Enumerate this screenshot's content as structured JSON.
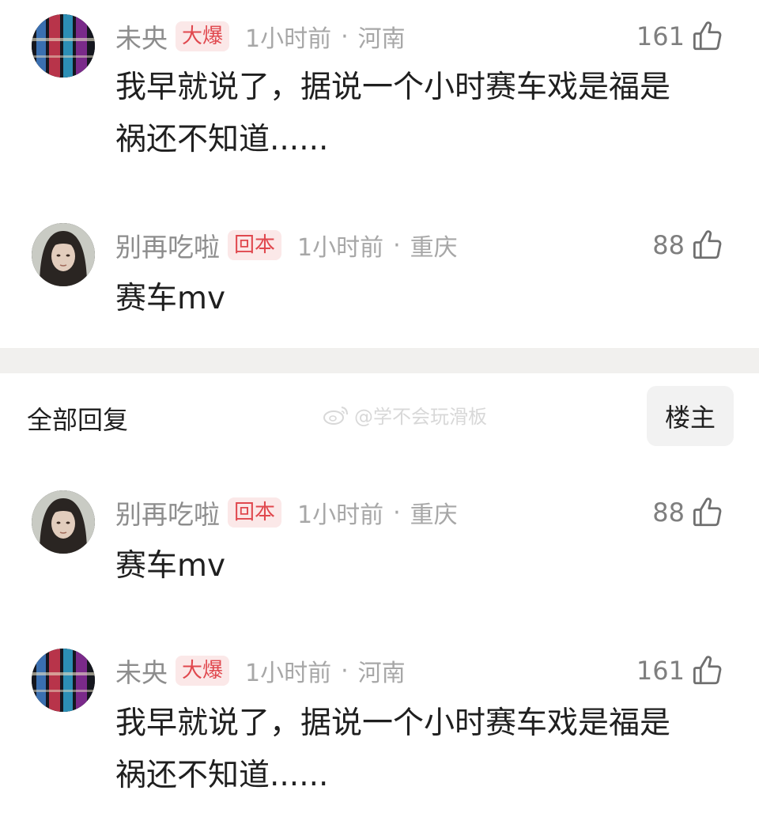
{
  "comments": [
    {
      "username": "未央",
      "badge": "大爆",
      "time": "1小时前",
      "dot": "·",
      "location": "河南",
      "likes": "161",
      "text_line1": "我早就说了，据说一个小时赛车戏是福是",
      "text_line2": "祸还不知道......"
    },
    {
      "username": "别再吃啦",
      "badge": "回本",
      "time": "1小时前",
      "dot": "·",
      "location": "重庆",
      "likes": "88",
      "text_line1": "赛车mv"
    }
  ],
  "replies_section": {
    "title": "全部回复",
    "op_button": "楼主",
    "watermark": "@学不会玩滑板"
  },
  "replies": [
    {
      "username": "别再吃啦",
      "badge": "回本",
      "time": "1小时前",
      "dot": "·",
      "location": "重庆",
      "likes": "88",
      "text_line1": "赛车mv"
    },
    {
      "username": "未央",
      "badge": "大爆",
      "time": "1小时前",
      "dot": "·",
      "location": "河南",
      "likes": "161",
      "text_line1": "我早就说了，据说一个小时赛车戏是福是",
      "text_line2": "祸还不知道......"
    }
  ],
  "colors": {
    "badge_text": "#e0484e",
    "badge_bg": "#fbe8e8",
    "meta_text": "#a7a7a7",
    "divider": "#f1f0ee"
  }
}
